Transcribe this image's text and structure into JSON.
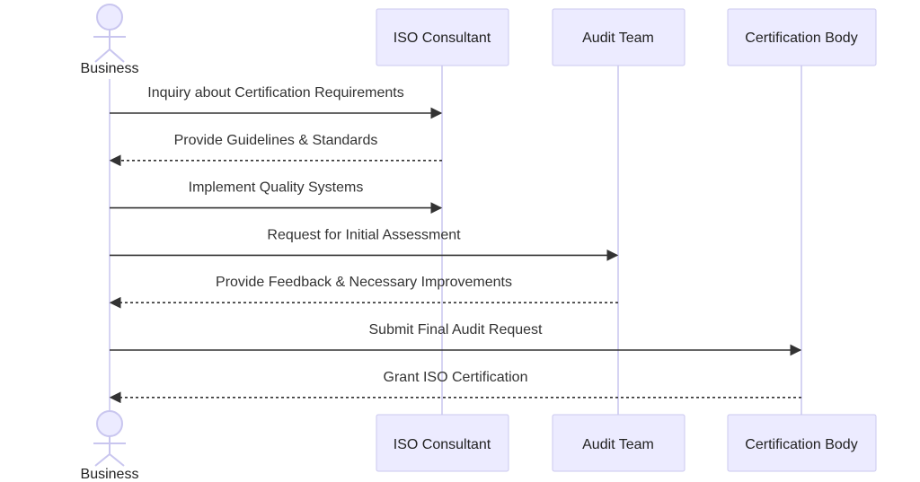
{
  "diagram": {
    "type": "sequence",
    "colors": {
      "participant_fill": "#ecebff",
      "participant_border": "#cbc8ef",
      "lifeline": "#c9c6ef",
      "message": "#333333",
      "text": "#222222"
    },
    "actors": [
      {
        "id": "business",
        "label": "Business",
        "kind": "actor"
      },
      {
        "id": "consultant",
        "label": "ISO Consultant",
        "kind": "participant"
      },
      {
        "id": "audit",
        "label": "Audit Team",
        "kind": "participant"
      },
      {
        "id": "certbody",
        "label": "Certification Body",
        "kind": "participant"
      }
    ],
    "messages": [
      {
        "from": "business",
        "to": "consultant",
        "label": "Inquiry about Certification Requirements",
        "style": "solid"
      },
      {
        "from": "consultant",
        "to": "business",
        "label": "Provide Guidelines & Standards",
        "style": "dashed"
      },
      {
        "from": "business",
        "to": "consultant",
        "label": "Implement Quality Systems",
        "style": "solid"
      },
      {
        "from": "business",
        "to": "audit",
        "label": "Request for Initial Assessment",
        "style": "solid"
      },
      {
        "from": "audit",
        "to": "business",
        "label": "Provide Feedback & Necessary Improvements",
        "style": "dashed"
      },
      {
        "from": "business",
        "to": "certbody",
        "label": "Submit Final Audit Request",
        "style": "solid"
      },
      {
        "from": "certbody",
        "to": "business",
        "label": "Grant ISO Certification",
        "style": "dashed"
      }
    ]
  }
}
